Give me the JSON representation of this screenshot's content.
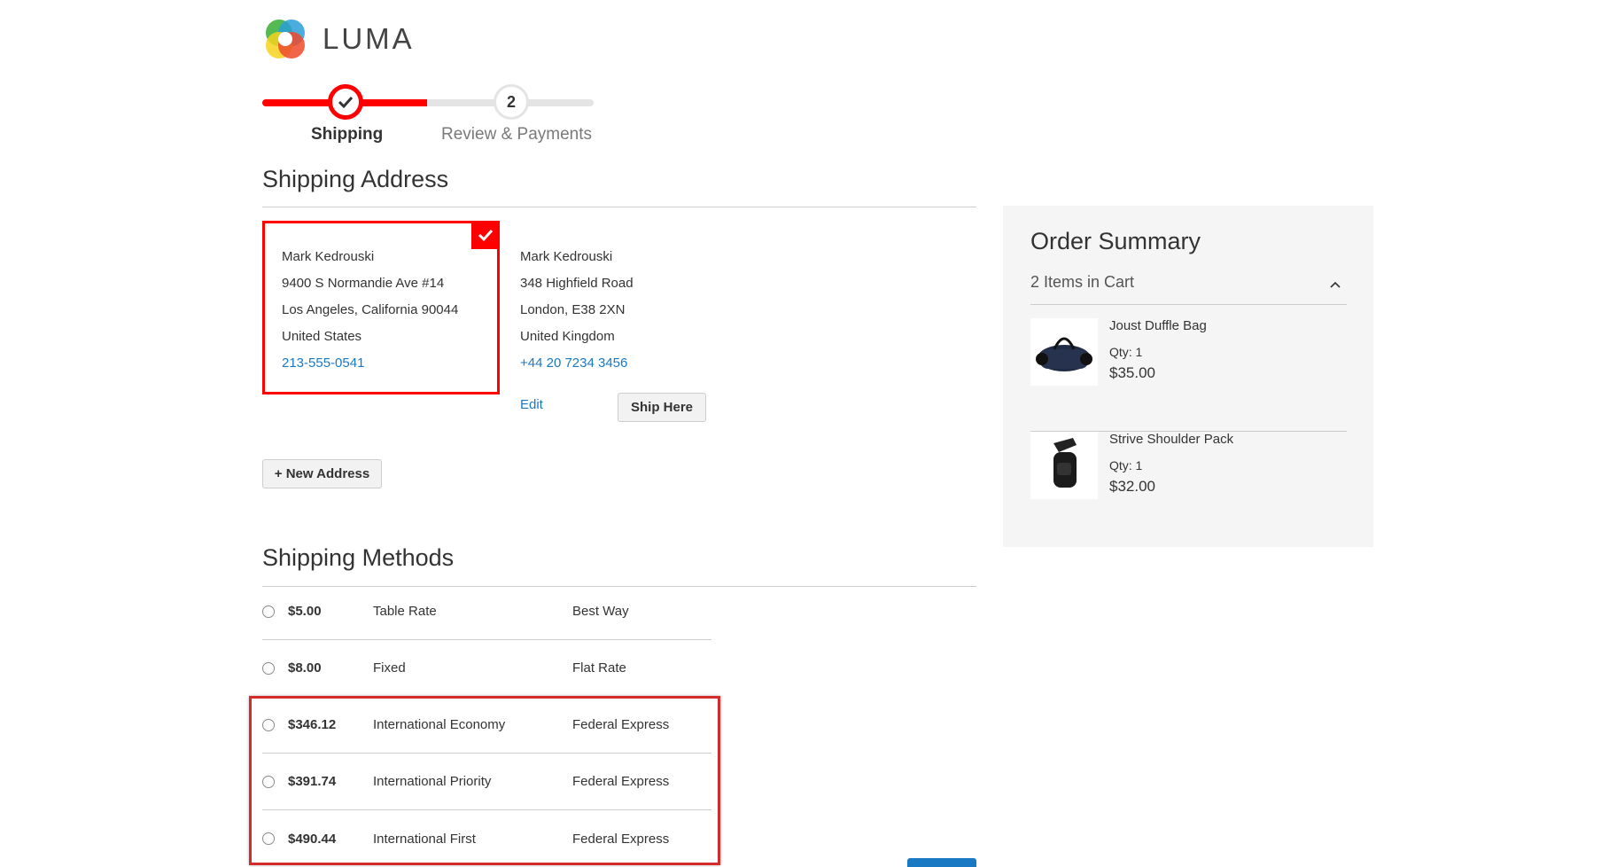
{
  "brand": {
    "name": "LUMA"
  },
  "progress": {
    "steps": [
      {
        "label": "Shipping",
        "number": "",
        "state": "complete"
      },
      {
        "label": "Review & Payments",
        "number": "2",
        "state": "pending"
      }
    ],
    "accent_color": "#ff0000"
  },
  "shipping_address": {
    "title": "Shipping Address",
    "addresses": [
      {
        "selected": true,
        "name": "Mark Kedrouski",
        "street": "9400 S Normandie Ave #14",
        "city_line": "Los Angeles, California 90044",
        "country": "United States",
        "phone": "213-555-0541"
      },
      {
        "selected": false,
        "name": "Mark Kedrouski",
        "street": "348 Highfield Road",
        "city_line": "London, E38 2XN",
        "country": "United Kingdom",
        "phone": "+44 20 7234 3456",
        "edit_label": "Edit",
        "ship_here_label": "Ship Here"
      }
    ],
    "new_address_label": "+ New Address"
  },
  "shipping_methods": {
    "title": "Shipping Methods",
    "rows": [
      {
        "price": "$5.00",
        "method": "Table Rate",
        "carrier": "Best Way"
      },
      {
        "price": "$8.00",
        "method": "Fixed",
        "carrier": "Flat Rate"
      },
      {
        "price": "$346.12",
        "method": "International Economy",
        "carrier": "Federal Express"
      },
      {
        "price": "$391.74",
        "method": "International Priority",
        "carrier": "Federal Express"
      },
      {
        "price": "$490.44",
        "method": "International First",
        "carrier": "Federal Express"
      }
    ]
  },
  "order_summary": {
    "title": "Order Summary",
    "items_in_cart": "2 Items in Cart",
    "items": [
      {
        "name": "Joust Duffle Bag",
        "qty": "Qty: 1",
        "price": "$35.00"
      },
      {
        "name": "Strive Shoulder Pack",
        "qty": "Qty: 1",
        "price": "$32.00"
      }
    ]
  },
  "colors": {
    "link": "#1979c3",
    "highlight": "#d52b2b",
    "summary_bg": "#f5f5f5"
  }
}
